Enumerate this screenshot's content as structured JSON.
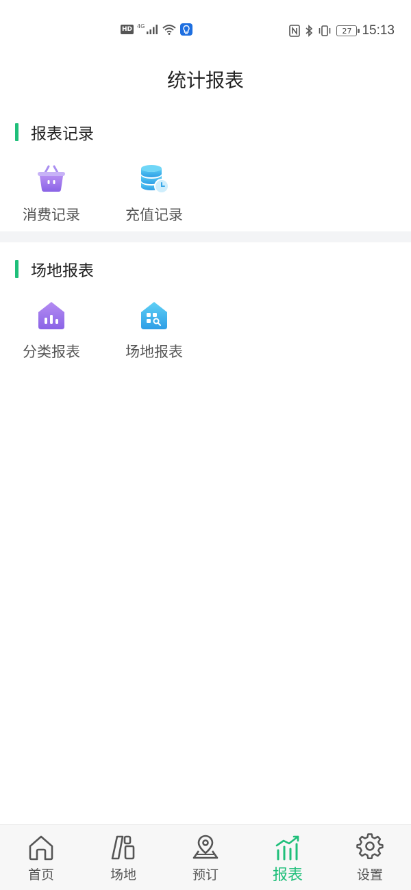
{
  "status_bar": {
    "hd": "HD",
    "network": "4G",
    "battery": "27",
    "time": "15:13"
  },
  "page": {
    "title": "统计报表"
  },
  "sections": [
    {
      "title": "报表记录",
      "items": [
        {
          "label": "消费记录",
          "icon": "basket-icon"
        },
        {
          "label": "充值记录",
          "icon": "database-clock-icon"
        }
      ]
    },
    {
      "title": "场地报表",
      "items": [
        {
          "label": "分类报表",
          "icon": "house-chart-icon"
        },
        {
          "label": "场地报表",
          "icon": "house-search-icon"
        }
      ]
    }
  ],
  "tabbar": {
    "active_color": "#1fbf7a",
    "tabs": [
      {
        "label": "首页",
        "icon": "home-icon"
      },
      {
        "label": "场地",
        "icon": "venue-icon"
      },
      {
        "label": "预订",
        "icon": "location-pin-icon"
      },
      {
        "label": "报表",
        "icon": "report-chart-icon",
        "active": true
      },
      {
        "label": "设置",
        "icon": "gear-icon"
      }
    ]
  }
}
